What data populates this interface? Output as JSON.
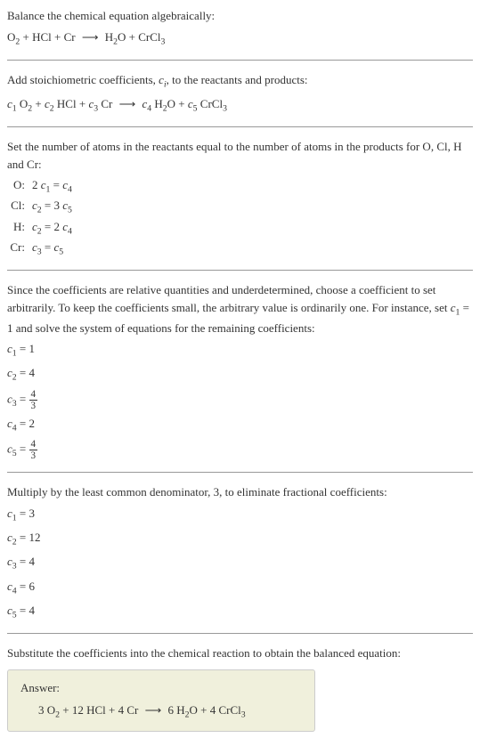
{
  "intro": {
    "line1": "Balance the chemical equation algebraically:",
    "eq_left_1": "O",
    "eq_left_1_sub": "2",
    "eq_plus1": " + HCl + Cr ",
    "arrow": "⟶",
    "eq_right_1": " H",
    "eq_right_1_sub": "2",
    "eq_right_2": "O + CrCl",
    "eq_right_2_sub": "3"
  },
  "step1": {
    "text1": "Add stoichiometric coefficients, ",
    "ci": "c",
    "ci_sub": "i",
    "text2": ", to the reactants and products:",
    "c1": "c",
    "c1_sub": "1",
    "sp1": " O",
    "sp1_sub": "2",
    "plus1": " + ",
    "c2": "c",
    "c2_sub": "2",
    "sp2": " HCl + ",
    "c3": "c",
    "c3_sub": "3",
    "sp3": " Cr ",
    "arrow": "⟶",
    "sp4": " ",
    "c4": "c",
    "c4_sub": "4",
    "sp5": " H",
    "sp5_sub": "2",
    "sp6": "O + ",
    "c5": "c",
    "c5_sub": "5",
    "sp7": " CrCl",
    "sp7_sub": "3"
  },
  "step2": {
    "text": "Set the number of atoms in the reactants equal to the number of atoms in the products for O, Cl, H and Cr:",
    "rows": [
      {
        "label": "O:",
        "lhs1": "2 ",
        "c_a": "c",
        "c_a_sub": "1",
        "mid": " = ",
        "c_b": "c",
        "c_b_sub": "4",
        "rhs": ""
      },
      {
        "label": "Cl:",
        "lhs1": "",
        "c_a": "c",
        "c_a_sub": "2",
        "mid": " = 3 ",
        "c_b": "c",
        "c_b_sub": "5",
        "rhs": ""
      },
      {
        "label": "H:",
        "lhs1": "",
        "c_a": "c",
        "c_a_sub": "2",
        "mid": " = 2 ",
        "c_b": "c",
        "c_b_sub": "4",
        "rhs": ""
      },
      {
        "label": "Cr:",
        "lhs1": "",
        "c_a": "c",
        "c_a_sub": "3",
        "mid": " = ",
        "c_b": "c",
        "c_b_sub": "5",
        "rhs": ""
      }
    ]
  },
  "step3": {
    "text1": "Since the coefficients are relative quantities and underdetermined, choose a coefficient to set arbitrarily. To keep the coefficients small, the arbitrary value is ordinarily one. For instance, set ",
    "c1": "c",
    "c1_sub": "1",
    "text2": " = 1 and solve the system of equations for the remaining coefficients:",
    "vals": [
      {
        "c": "c",
        "sub": "1",
        "eq": " = 1",
        "frac_num": "",
        "frac_den": ""
      },
      {
        "c": "c",
        "sub": "2",
        "eq": " = 4",
        "frac_num": "",
        "frac_den": ""
      },
      {
        "c": "c",
        "sub": "3",
        "eq": " = ",
        "frac_num": "4",
        "frac_den": "3"
      },
      {
        "c": "c",
        "sub": "4",
        "eq": " = 2",
        "frac_num": "",
        "frac_den": ""
      },
      {
        "c": "c",
        "sub": "5",
        "eq": " = ",
        "frac_num": "4",
        "frac_den": "3"
      }
    ]
  },
  "step4": {
    "text": "Multiply by the least common denominator, 3, to eliminate fractional coefficients:",
    "vals": [
      {
        "c": "c",
        "sub": "1",
        "eq": " = 3"
      },
      {
        "c": "c",
        "sub": "2",
        "eq": " = 12"
      },
      {
        "c": "c",
        "sub": "3",
        "eq": " = 4"
      },
      {
        "c": "c",
        "sub": "4",
        "eq": " = 6"
      },
      {
        "c": "c",
        "sub": "5",
        "eq": " = 4"
      }
    ]
  },
  "step5": {
    "text": "Substitute the coefficients into the chemical reaction to obtain the balanced equation:"
  },
  "answer": {
    "label": "Answer:",
    "p1": "3 O",
    "p1_sub": "2",
    "p2": " + 12 HCl + 4 Cr ",
    "arrow": "⟶",
    "p3": " 6 H",
    "p3_sub": "2",
    "p4": "O + 4 CrCl",
    "p4_sub": "3"
  }
}
